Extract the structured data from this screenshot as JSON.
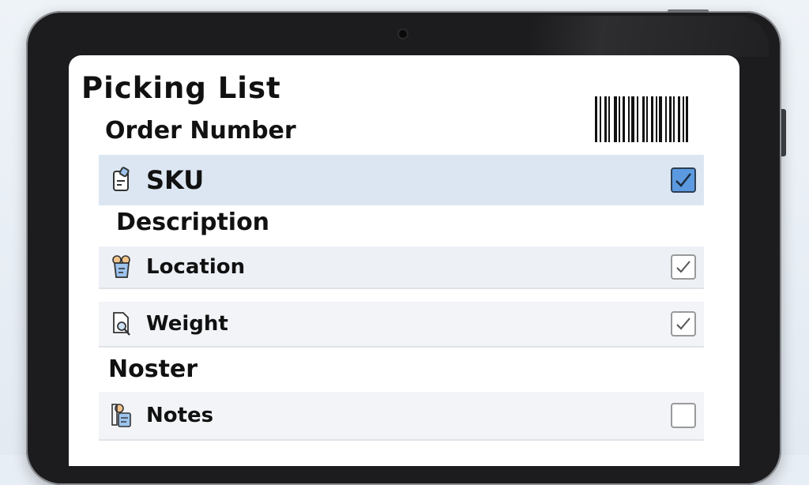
{
  "app": {
    "title": "Picking List",
    "subtitle": "Order Number"
  },
  "sections": {
    "description": "Description",
    "noster": "Noster"
  },
  "rows": [
    {
      "label": "SKU",
      "icon": "clipboard-tag-icon",
      "checked": true
    },
    {
      "label": "Location",
      "icon": "bag-receipt-icon",
      "checked": true
    },
    {
      "label": "Weight",
      "icon": "document-search-icon",
      "checked": true
    },
    {
      "label": "Notes",
      "icon": "person-note-icon",
      "checked": false
    }
  ],
  "colors": {
    "highlight_row": "#dce6f2",
    "checkbox_active": "#5b9ae0",
    "row_bg": "#f2f4f7"
  }
}
